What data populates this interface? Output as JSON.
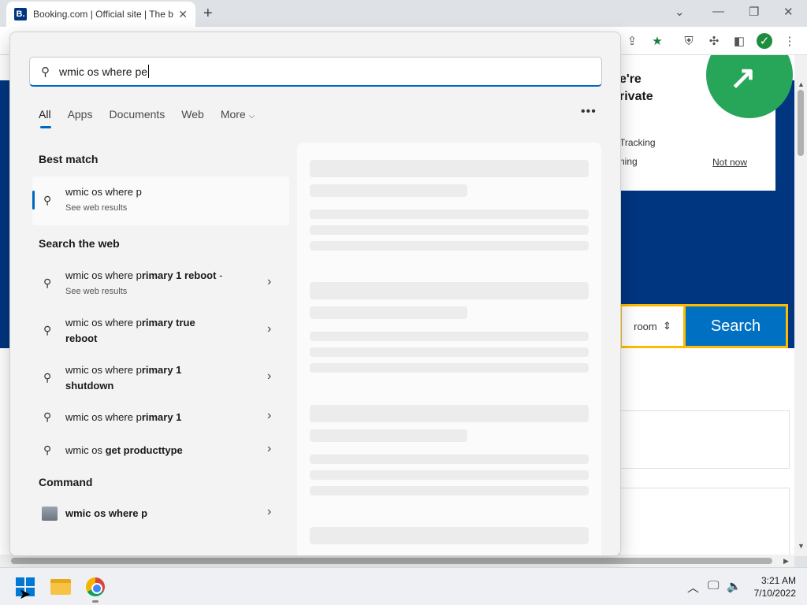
{
  "browser": {
    "tab_title": "Booking.com | Official site | The b",
    "favicon_letter": "B."
  },
  "page": {
    "popup_line1": "e're",
    "popup_line2": "rivate",
    "popup_tracking": "Tracking",
    "popup_ning": "ning",
    "popup_not_now": "Not now",
    "room_label": "room",
    "search_button": "Search"
  },
  "search": {
    "query": "wmic os where pe",
    "tabs": [
      "All",
      "Apps",
      "Documents",
      "Web",
      "More"
    ],
    "best_match_heading": "Best match",
    "best_match": {
      "title": "wmic os where p",
      "subtitle": "See web results"
    },
    "web_heading": "Search the web",
    "web_results": [
      {
        "prefix": "wmic os where p",
        "bold": "rimary 1 reboot",
        "suffix": " -",
        "subtitle": "See web results"
      },
      {
        "prefix": "wmic os where p",
        "bold": "rimary true",
        "line2": "reboot"
      },
      {
        "prefix": "wmic os where p",
        "bold": "rimary 1",
        "line2": "shutdown"
      },
      {
        "prefix": "wmic os where p",
        "bold": "rimary 1"
      },
      {
        "prefix": "wmic os ",
        "bold": "get producttype"
      }
    ],
    "command_heading": "Command",
    "command": {
      "prefix": "wmic os where p"
    }
  },
  "taskbar": {
    "time": "3:21 AM",
    "date": "7/10/2022"
  }
}
